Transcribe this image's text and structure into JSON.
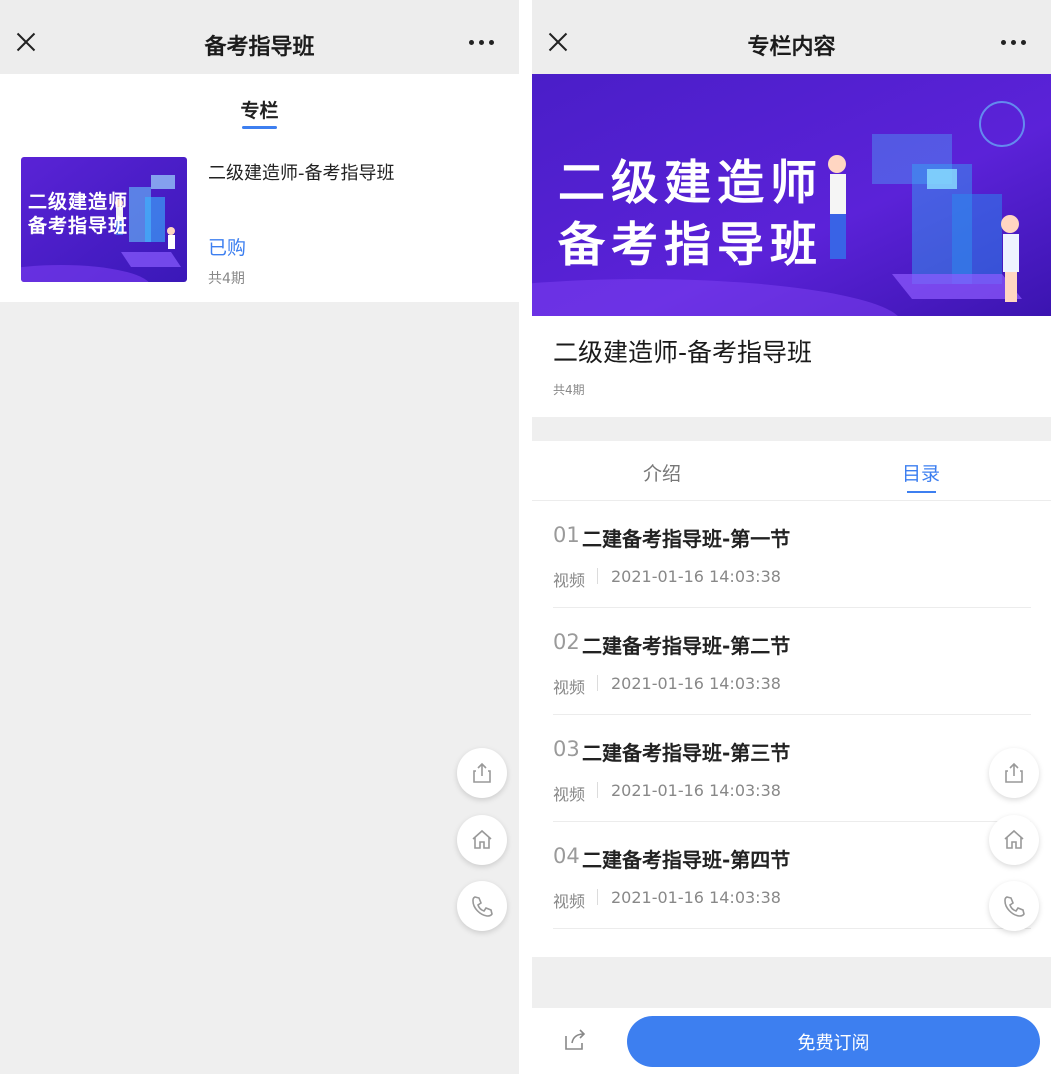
{
  "left_panel": {
    "nav": {
      "title": "备考指导班"
    },
    "tab_label": "专栏",
    "card": {
      "thumb_line1": "二级建造师",
      "thumb_line2": "备考指导班",
      "title": "二级建造师-备考指导班",
      "status": "已购",
      "count": "共4期"
    },
    "fab_icons": [
      "share-icon",
      "home-icon",
      "phone-icon"
    ]
  },
  "right_panel": {
    "nav": {
      "title": "专栏内容"
    },
    "banner": {
      "line1": "二级建造师",
      "line2": "备考指导班"
    },
    "info": {
      "title": "二级建造师-备考指导班",
      "count": "共4期"
    },
    "tabs": [
      {
        "label": "介绍",
        "active": false
      },
      {
        "label": "目录",
        "active": true
      }
    ],
    "lessons": [
      {
        "num": "01",
        "title": "二建备考指导班-第一节",
        "type": "视频",
        "date": "2021-01-16 14:03:38"
      },
      {
        "num": "02",
        "title": "二建备考指导班-第二节",
        "type": "视频",
        "date": "2021-01-16 14:03:38"
      },
      {
        "num": "03",
        "title": "二建备考指导班-第三节",
        "type": "视频",
        "date": "2021-01-16 14:03:38"
      },
      {
        "num": "04",
        "title": "二建备考指导班-第四节",
        "type": "视频",
        "date": "2021-01-16 14:03:38"
      }
    ],
    "subscribe_label": "免费订阅"
  },
  "colors": {
    "accent": "#3d7ff0",
    "navbar_bg": "#ededed",
    "page_bg": "#efefef",
    "banner_bg": "#4a1ec8"
  }
}
